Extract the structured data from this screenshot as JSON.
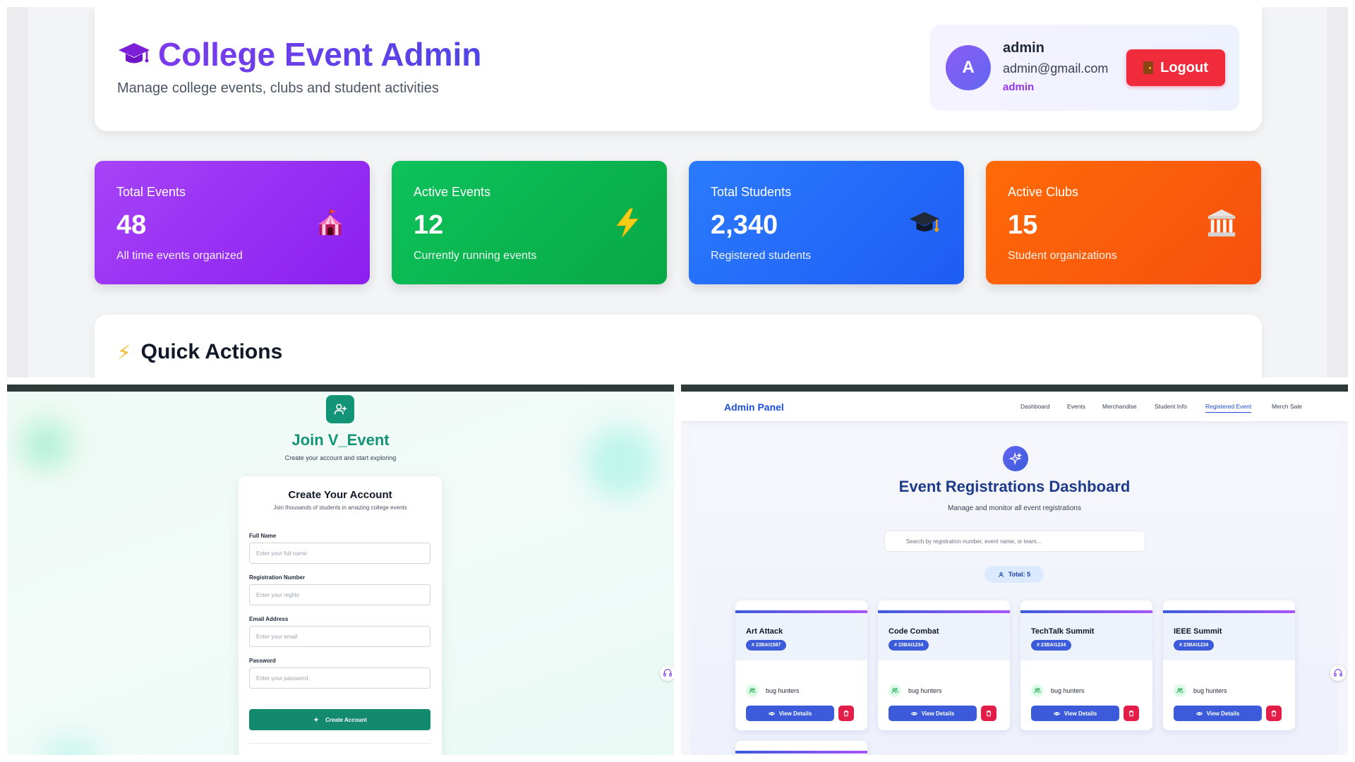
{
  "header": {
    "title": "College Event Admin",
    "subtitle": "Manage college events, clubs and student activities",
    "user": {
      "avatar_letter": "A",
      "name": "admin",
      "email": "admin@gmail.com",
      "role": "admin"
    },
    "logout_label": "Logout"
  },
  "stats": [
    {
      "label": "Total Events",
      "value": "48",
      "desc": "All time events organized",
      "icon": "circus-tent-icon",
      "color": "#9b32f5"
    },
    {
      "label": "Active Events",
      "value": "12",
      "desc": "Currently running events",
      "icon": "lightning-icon",
      "color": "#0bb552"
    },
    {
      "label": "Total Students",
      "value": "2,340",
      "desc": "Registered students",
      "icon": "graduation-cap-icon",
      "color": "#2569f9"
    },
    {
      "label": "Active Clubs",
      "value": "15",
      "desc": "Student organizations",
      "icon": "classical-building-icon",
      "color": "#fb5e0b"
    }
  ],
  "quick_actions": {
    "title": "Quick Actions"
  },
  "signup": {
    "title": "Join V_Event",
    "subtitle": "Create your account and start exploring",
    "card_title": "Create Your Account",
    "card_subtitle": "Join thousands of students in amazing college events",
    "fields": [
      {
        "label": "Full Name",
        "placeholder": "Enter your full name"
      },
      {
        "label": "Registration Number",
        "placeholder": "Enter your regNo"
      },
      {
        "label": "Email Address",
        "placeholder": "Enter your email"
      },
      {
        "label": "Password",
        "placeholder": "Enter your password"
      }
    ],
    "submit_label": "Create Account"
  },
  "admin_panel": {
    "brand": "Admin Panel",
    "nav": [
      "Dashboard",
      "Events",
      "Merchandise",
      "Student Info",
      "Registered Event",
      "Merch Sale"
    ],
    "active_nav": "Registered Event",
    "title": "Event Registrations Dashboard",
    "subtitle": "Manage and monitor all event registrations",
    "search_placeholder": "Search by registration number, event name, or team...",
    "total_label": "Total: 5",
    "events": [
      {
        "name": "Art Attack",
        "reg": "# 23BAI1587",
        "team": "bug hunters",
        "view_label": "View Details"
      },
      {
        "name": "Code Combat",
        "reg": "# 23BAI1234",
        "team": "bug hunters",
        "view_label": "View Details"
      },
      {
        "name": "TechTalk Summit",
        "reg": "# 23BAI1234",
        "team": "bug hunters",
        "view_label": "View Details"
      },
      {
        "name": "IEEE Summit",
        "reg": "# 23BAI1234",
        "team": "bug hunters",
        "view_label": "View Details"
      }
    ]
  },
  "colors": {
    "primary_purple": "#7c3aed",
    "logout_red": "#ef2b3c",
    "teal": "#149477",
    "admin_blue": "#1d4ed8"
  }
}
